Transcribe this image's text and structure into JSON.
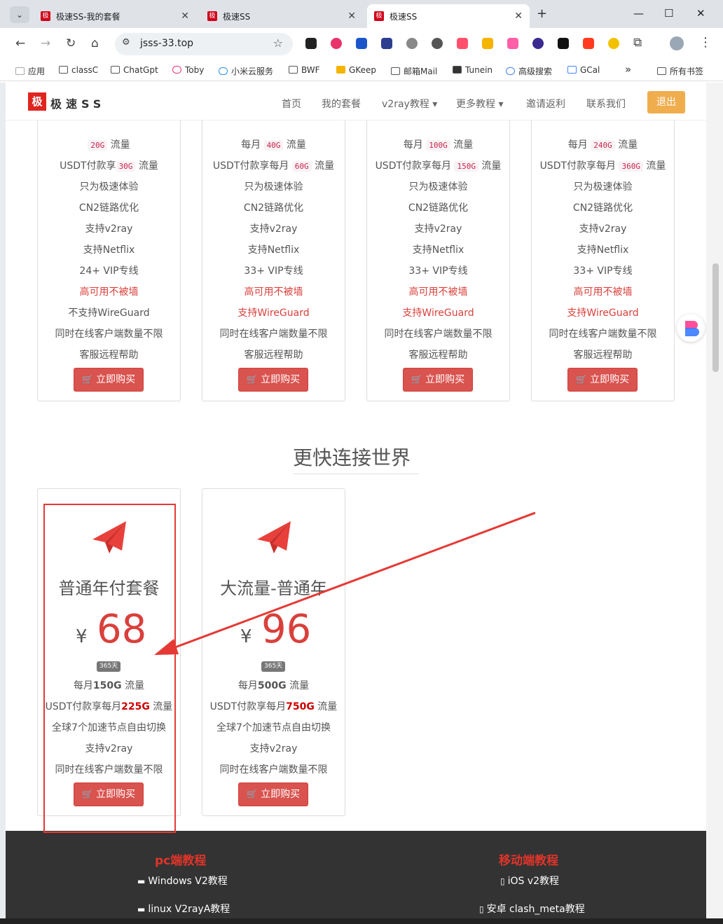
{
  "browser": {
    "tabs": [
      {
        "title": "极速SS-我的套餐",
        "fav": "极"
      },
      {
        "title": "极速SS",
        "fav": "极"
      },
      {
        "title": "极速SS",
        "fav": "极"
      }
    ],
    "new_tab": "+",
    "url": "jsss-33.top",
    "bookmarks": [
      "应用",
      "classC",
      "ChatGpt",
      "Toby",
      "小米云服务",
      "BWF",
      "GKeep",
      "邮箱Mail",
      "Tunein",
      "高级搜索",
      "GCal",
      "所有书签"
    ],
    "bookmarks_more": "»"
  },
  "site": {
    "logo_mark": "极",
    "logo_text": "极速SS",
    "nav": [
      "首页",
      "我的套餐",
      "v2ray教程 ▾",
      "更多教程 ▾",
      "邀请返利",
      "联系我们"
    ],
    "logout": "退出"
  },
  "plans_top": [
    {
      "f1_pre": "",
      "f1_code": "20G",
      "f1_suf": " 流量",
      "f2_pre": "USDT付款享",
      "f2_code": "30G",
      "f2_suf": " 流量",
      "f3": "只为极速体验",
      "f4": "CN2链路优化",
      "f5": "支持v2ray",
      "f6": "支持Netflix",
      "f7": "24+ VIP专线",
      "f8": "高可用不被墙",
      "f9": "不支持WireGuard",
      "f10": "同时在线客户端数量不限",
      "f11": "客服远程帮助",
      "buy": "立即购买"
    },
    {
      "f1_pre": "每月 ",
      "f1_code": "40G",
      "f1_suf": " 流量",
      "f2_pre": "USDT付款享每月 ",
      "f2_code": "60G",
      "f2_suf": " 流量",
      "f3": "只为极速体验",
      "f4": "CN2链路优化",
      "f5": "支持v2ray",
      "f6": "支持Netflix",
      "f7": "33+ VIP专线",
      "f8": "高可用不被墙",
      "f9": "支持WireGuard",
      "f10": "同时在线客户端数量不限",
      "f11": "客服远程帮助",
      "buy": "立即购买"
    },
    {
      "f1_pre": "每月 ",
      "f1_code": "100G",
      "f1_suf": " 流量",
      "f2_pre": "USDT付款享每月 ",
      "f2_code": "150G",
      "f2_suf": " 流量",
      "f3": "只为极速体验",
      "f4": "CN2链路优化",
      "f5": "支持v2ray",
      "f6": "支持Netflix",
      "f7": "33+ VIP专线",
      "f8": "高可用不被墙",
      "f9": "支持WireGuard",
      "f10": "同时在线客户端数量不限",
      "f11": "客服远程帮助",
      "buy": "立即购买"
    },
    {
      "f1_pre": "每月 ",
      "f1_code": "240G",
      "f1_suf": " 流量",
      "f2_pre": "USDT付款享每月 ",
      "f2_code": "360G",
      "f2_suf": " 流量",
      "f3": "只为极速体验",
      "f4": "CN2链路优化",
      "f5": "支持v2ray",
      "f6": "支持Netflix",
      "f7": "33+ VIP专线",
      "f8": "高可用不被墙",
      "f9": "支持WireGuard",
      "f10": "同时在线客户端数量不限",
      "f11": "客服远程帮助",
      "buy": "立即购买"
    }
  ],
  "section_title": "更快连接世界",
  "plans_year": [
    {
      "name": "普通年付套餐",
      "currency": "¥",
      "price": "68",
      "badge": "365天",
      "f1_pre": "每月",
      "f1_bold": "150G",
      "f1_suf": " 流量",
      "f2_pre": "USDT付款享每月",
      "f2_hl": "225G",
      "f2_suf": " 流量",
      "f3": "全球7个加速节点自由切换",
      "f4": "支持v2ray",
      "f5": "同时在线客户端数量不限",
      "buy": "立即购买"
    },
    {
      "name": "大流量-普通年",
      "currency": "¥",
      "price": "96",
      "badge": "365天",
      "f1_pre": "每月",
      "f1_bold": "500G",
      "f1_suf": " 流量",
      "f2_pre": "USDT付款享每月",
      "f2_hl": "750G",
      "f2_suf": " 流量",
      "f3": "全球7个加速节点自由切换",
      "f4": "支持v2ray",
      "f5": "同时在线客户端数量不限",
      "buy": "立即购买"
    }
  ],
  "footer": {
    "pc_title": "pc端教程",
    "mobile_title": "移动端教程",
    "pc_links": [
      "Windows V2教程",
      "linux V2rayA教程"
    ],
    "mobile_links": [
      "iOS v2教程",
      "安卓 clash_meta教程"
    ]
  },
  "colors": {
    "accent_red": "#d9534f",
    "logout_orange": "#f0ad4e",
    "footer_bg": "#333333",
    "annotation_red": "#e53935"
  }
}
